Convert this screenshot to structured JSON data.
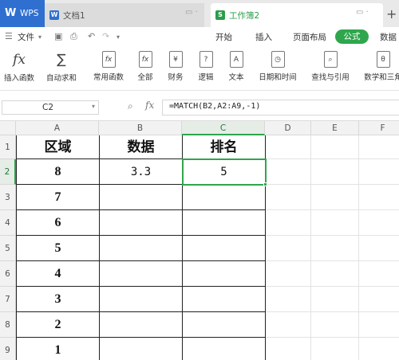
{
  "tabs": {
    "wps": "WPS",
    "doc": "文档1",
    "book": "工作簿2",
    "plus": "+"
  },
  "menu": {
    "file": "文件",
    "items": [
      "开始",
      "插入",
      "页面布局",
      "公式",
      "数据"
    ],
    "active": "公式"
  },
  "ribbon": [
    {
      "label": "插入函数",
      "icon": "fx-icon",
      "glyph": "fx"
    },
    {
      "label": "自动求和",
      "icon": "sigma-icon",
      "glyph": "∑"
    },
    {
      "label": "常用函数",
      "icon": "function-star-icon",
      "glyph": "fx"
    },
    {
      "label": "全部",
      "icon": "all-functions-icon",
      "glyph": "fx"
    },
    {
      "label": "财务",
      "icon": "finance-icon",
      "glyph": "¥"
    },
    {
      "label": "逻辑",
      "icon": "logic-icon",
      "glyph": "?"
    },
    {
      "label": "文本",
      "icon": "text-icon",
      "glyph": "A"
    },
    {
      "label": "日期和时间",
      "icon": "clock-icon",
      "glyph": "◷"
    },
    {
      "label": "查找与引用",
      "icon": "lookup-icon",
      "glyph": "⌕"
    },
    {
      "label": "数学和三角",
      "icon": "math-icon",
      "glyph": "θ"
    }
  ],
  "formula_bar": {
    "name_box": "C2",
    "fx": "fx",
    "formula": "=MATCH(B2,A2:A9,-1)"
  },
  "columns": [
    "A",
    "B",
    "C",
    "D",
    "E",
    "F"
  ],
  "rows": [
    "1",
    "2",
    "3",
    "4",
    "5",
    "6",
    "7",
    "8",
    "9"
  ],
  "active_cell": {
    "column": "C",
    "row": "2"
  },
  "table": {
    "headers": [
      "区域",
      "数据",
      "排名"
    ],
    "region_values": [
      "8",
      "7",
      "6",
      "5",
      "4",
      "3",
      "2",
      "1"
    ],
    "data_value": "3.3",
    "rank_value": "5"
  },
  "colors": {
    "accent": "#2fa64d",
    "wps_blue": "#2f6fd0"
  }
}
